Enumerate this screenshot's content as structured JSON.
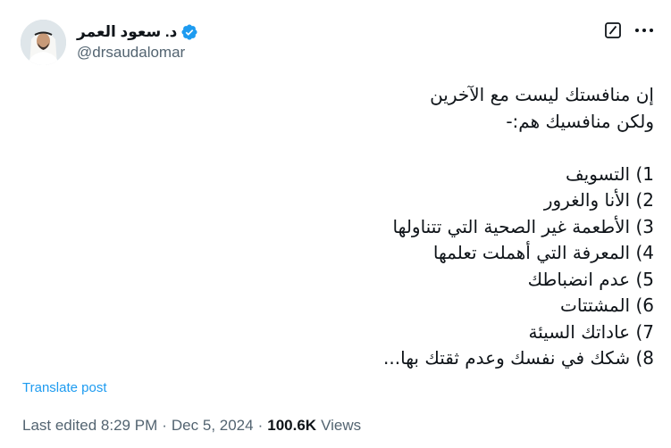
{
  "author": {
    "display_name": "د. سعود العمر",
    "handle": "@drsaudalomar",
    "verified": true,
    "avatar_icon": "user-avatar-photo"
  },
  "actions": {
    "grok_icon": "grok-icon",
    "more_icon": "more-horizontal-icon"
  },
  "post": {
    "lines": [
      "إن منافستك ليست مع الآخرين",
      "ولكن منافسيك هم:-",
      "",
      "1) التسويف",
      "2) الأنا والغرور",
      "3) الأطعمة غير الصحية التي تتناولها",
      "4) المعرفة التي أهملت تعلمها",
      "5) عدم انضباطك",
      "6) المشتتات",
      "7) عاداتك السيئة",
      "8) شكك في نفسك وعدم ثقتك بها..."
    ]
  },
  "translate_label": "Translate post",
  "meta": {
    "edited_label": "Last edited",
    "time": "8:29 PM",
    "date": "Dec 5, 2024",
    "separator": "·",
    "views_count": "100.6K",
    "views_label": "Views"
  },
  "colors": {
    "text": "#0f1419",
    "secondary": "#536471",
    "link": "#1d9bf0",
    "verified": "#1d9bf0"
  }
}
